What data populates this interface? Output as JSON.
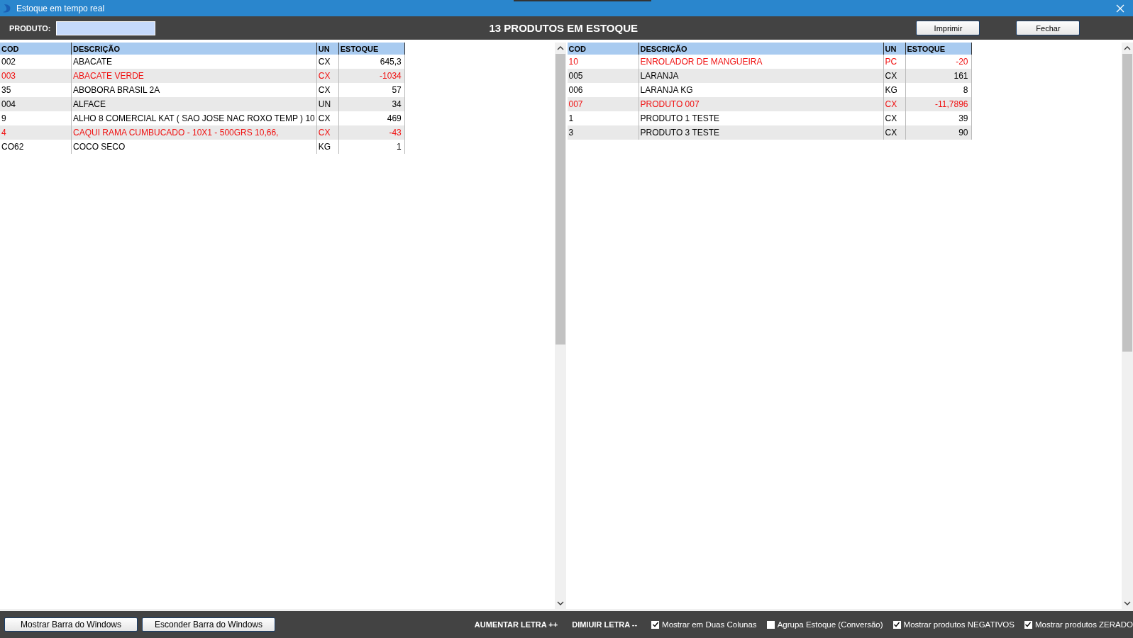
{
  "window": {
    "title": "Estoque em tempo real"
  },
  "toolbar": {
    "search_label": "PRODUTO:",
    "heading": "13 PRODUTOS EM ESTOQUE",
    "buttons": [
      "Imprimir",
      "Fechar"
    ]
  },
  "tables": [
    {
      "columns": [
        "COD",
        "DESCRIÇÃO",
        "UN",
        "ESTOQUE"
      ],
      "rows": [
        {
          "cod": "002",
          "descricao": "ABACATE",
          "un": "CX",
          "estoque": "645,3",
          "negative": false
        },
        {
          "cod": "003",
          "descricao": "ABACATE VERDE",
          "un": "CX",
          "estoque": "-1034",
          "negative": true
        },
        {
          "cod": "35",
          "descricao": "ABOBORA BRASIL 2A",
          "un": "CX",
          "estoque": "57",
          "negative": false
        },
        {
          "cod": "004",
          "descricao": "ALFACE",
          "un": "UN",
          "estoque": "34",
          "negative": false
        },
        {
          "cod": "9",
          "descricao": "ALHO 8 COMERCIAL KAT ( SAO JOSE NAC ROXO TEMP ) 10",
          "un": "CX",
          "estoque": "469",
          "negative": false
        },
        {
          "cod": "4",
          "descricao": "CAQUI RAMA CUMBUCADO - 10X1 - 500GRS 10,66,",
          "un": "CX",
          "estoque": "-43",
          "negative": true
        },
        {
          "cod": "CO62",
          "descricao": "COCO SECO",
          "un": "KG",
          "estoque": "1",
          "negative": false
        }
      ]
    },
    {
      "columns": [
        "COD",
        "DESCRIÇÃO",
        "UN",
        "ESTOQUE"
      ],
      "rows": [
        {
          "cod": "10",
          "descricao": "ENROLADOR DE MANGUEIRA",
          "un": "PC",
          "estoque": "-20",
          "negative": true
        },
        {
          "cod": "005",
          "descricao": "LARANJA",
          "un": "CX",
          "estoque": "161",
          "negative": false
        },
        {
          "cod": "006",
          "descricao": "LARANJA KG",
          "un": "KG",
          "estoque": "8",
          "negative": false
        },
        {
          "cod": "007",
          "descricao": "PRODUTO 007",
          "un": "CX",
          "estoque": "-11,7896",
          "negative": true
        },
        {
          "cod": "1",
          "descricao": "PRODUTO 1 TESTE",
          "un": "CX",
          "estoque": "39",
          "negative": false
        },
        {
          "cod": "3",
          "descricao": "PRODUTO 3 TESTE",
          "un": "CX",
          "estoque": "90",
          "negative": false
        }
      ]
    }
  ],
  "footer": {
    "buttons": [
      "Mostrar Barra do Windows",
      "Esconder Barra do Windows"
    ],
    "links": [
      "AUMENTAR LETRA ++",
      "DIMIUIR LETRA --"
    ],
    "checkboxes": [
      {
        "label": "Mostrar em Duas Colunas",
        "checked": true
      },
      {
        "label": "Agrupa Estoque (Conversão)",
        "checked": false
      },
      {
        "label": "Mostrar produtos NEGATIVOS",
        "checked": true
      },
      {
        "label": "Mostrar produtos ZERADO",
        "checked": true
      }
    ]
  }
}
